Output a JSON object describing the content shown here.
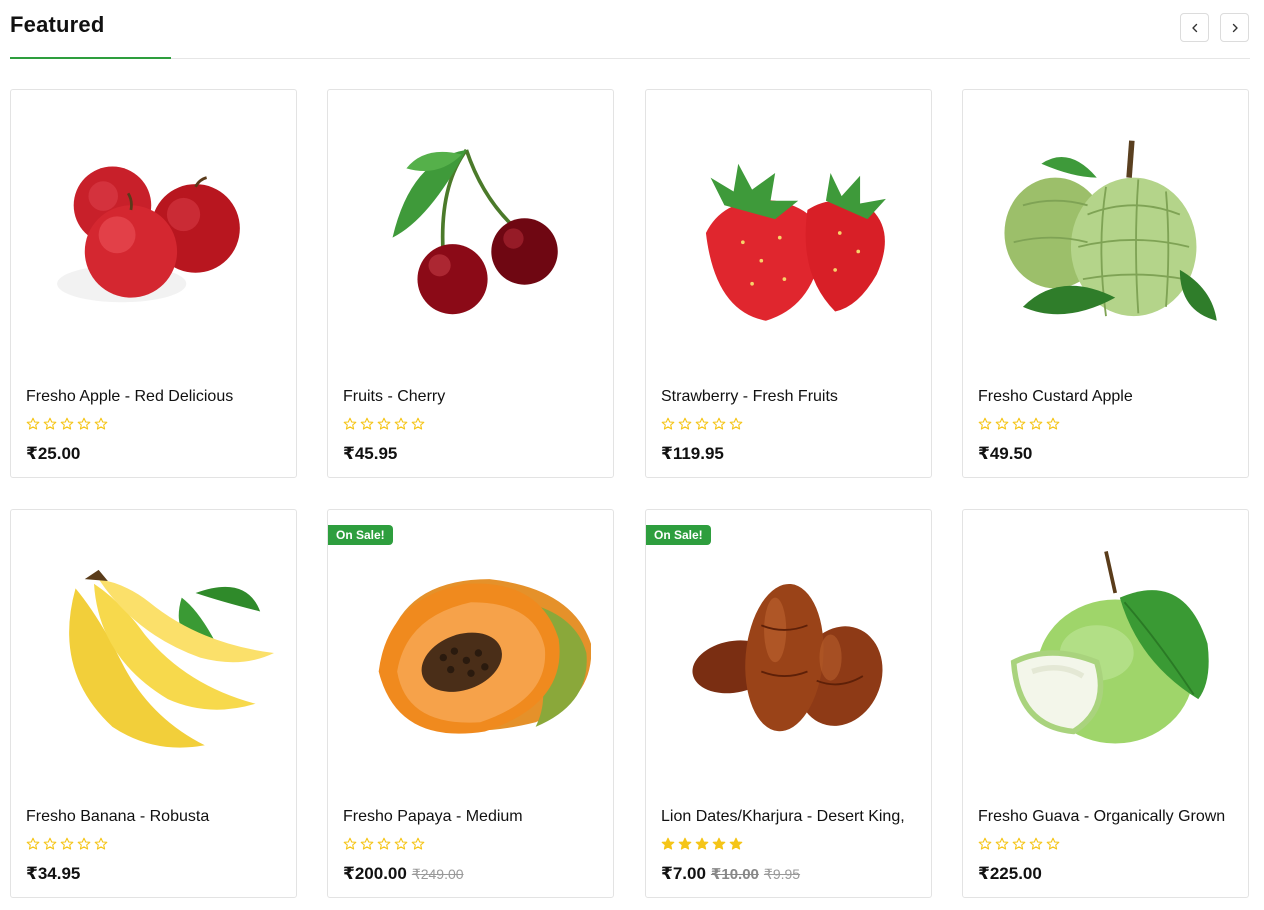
{
  "section": {
    "title": "Featured",
    "accent_color": "#2e9e3e",
    "prev_icon": "chevron-left-icon",
    "next_icon": "chevron-right-icon"
  },
  "star_color": "#f5c518",
  "products": [
    {
      "name": "Fresho Apple - Red Delicious",
      "rating": 0,
      "price": "₹25.00",
      "old_prices": [],
      "badge": null,
      "image": "apple"
    },
    {
      "name": "Fruits - Cherry",
      "rating": 0,
      "price": "₹45.95",
      "old_prices": [],
      "badge": null,
      "image": "cherry"
    },
    {
      "name": "Strawberry - Fresh Fruits",
      "rating": 0,
      "price": "₹119.95",
      "old_prices": [],
      "badge": null,
      "image": "strawberry"
    },
    {
      "name": "Fresho Custard Apple",
      "rating": 0,
      "price": "₹49.50",
      "old_prices": [],
      "badge": null,
      "image": "custard-apple"
    },
    {
      "name": "Fresho Banana - Robusta",
      "rating": 0,
      "price": "₹34.95",
      "old_prices": [],
      "badge": null,
      "image": "banana"
    },
    {
      "name": "Fresho Papaya - Medium",
      "rating": 0,
      "price": "₹200.00",
      "old_prices": [
        "₹249.00"
      ],
      "badge": "On Sale!",
      "image": "papaya"
    },
    {
      "name": "Lion Dates/Kharjura - Desert King,",
      "rating": 5,
      "price": "₹7.00",
      "old_prices": [
        "₹10.00",
        "₹9.95"
      ],
      "badge": "On Sale!",
      "image": "dates"
    },
    {
      "name": "Fresho Guava - Organically Grown",
      "rating": 0,
      "price": "₹225.00",
      "old_prices": [],
      "badge": null,
      "image": "guava"
    }
  ]
}
